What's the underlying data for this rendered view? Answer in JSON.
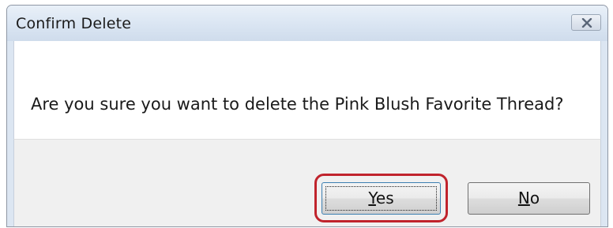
{
  "dialog": {
    "title": "Confirm Delete",
    "message": "Are you sure you want to delete the Pink Blush Favorite Thread?"
  },
  "buttons": {
    "yes": {
      "accel": "Y",
      "rest": "es"
    },
    "no": {
      "accel": "N",
      "rest": "o"
    }
  },
  "icons": {
    "close": "close-icon"
  },
  "colors": {
    "highlight": "#c0232c",
    "focus_border": "#3c7fb1"
  }
}
